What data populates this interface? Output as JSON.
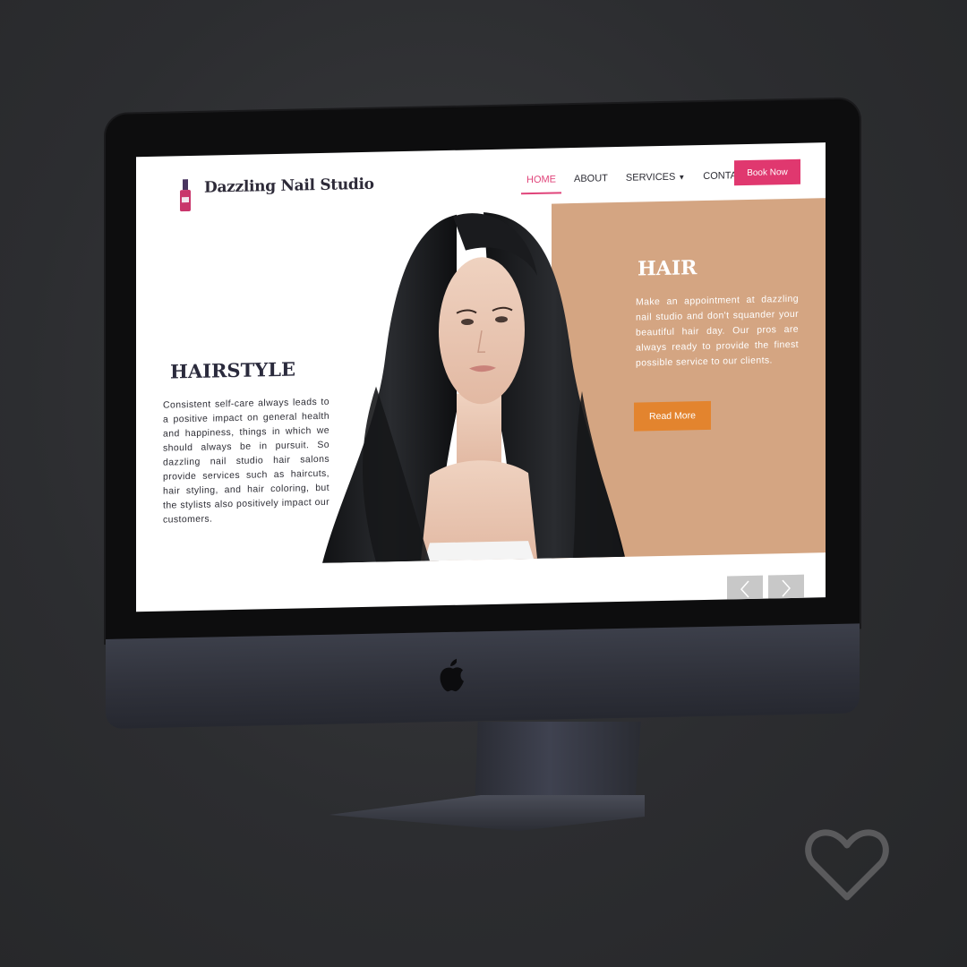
{
  "header": {
    "brand": "Dazzling Nail Studio",
    "nav": [
      {
        "label": "HOME",
        "active": true
      },
      {
        "label": "ABOUT",
        "active": false
      },
      {
        "label": "SERVICES",
        "active": false,
        "has_dropdown": true
      },
      {
        "label": "CONTACT",
        "active": false
      }
    ],
    "book_label": "Book Now"
  },
  "hero": {
    "left_title": "HAIRSTYLE",
    "left_text": "Consistent self-care always leads to a positive impact on general health and happiness, things in which we should always be in pursuit. So dazzling nail studio hair salons provide services such as haircuts, hair styling, and hair coloring, but the stylists also positively impact our customers.",
    "right_title": "HAIR",
    "right_text": "Make an appointment at dazzling nail studio and don't squander your beautiful hair day. Our pros are always ready to provide the finest possible service to our clients.",
    "read_more_label": "Read More"
  },
  "slider": {
    "prev_icon": "chevron-left-icon",
    "next_icon": "chevron-right-icon"
  },
  "colors": {
    "accent_pink": "#e0386f",
    "panel_tan": "#d4a582",
    "button_orange": "#e3842e",
    "background": "#2b2c2e"
  }
}
